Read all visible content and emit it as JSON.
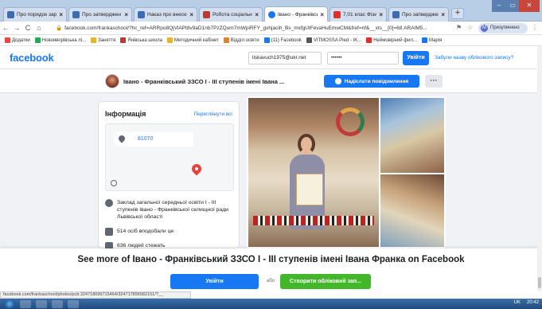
{
  "browser": {
    "tabs": [
      {
        "label": "Про порядок зар",
        "color": "#3b6cb7"
      },
      {
        "label": "Про затверджен",
        "color": "#3b6cb7"
      },
      {
        "label": "Наказ про внесен",
        "color": "#3b6cb7"
      },
      {
        "label": "Робота соціальн",
        "color": "#c0392b"
      },
      {
        "label": "Івано - Франківсь",
        "color": "#1877f2"
      },
      {
        "label": "7,01 клас Фізика",
        "color": "#e52d27"
      },
      {
        "label": "Про затверджен",
        "color": "#3b6cb7"
      }
    ],
    "url": "facebook.com/frankaschool/?hc_ref=ARRpo8QjVlAPt8v9aD1nb7PzZQum7mWpiRFY_gvhjacih_Bs_mxfgUtFevaHuEmwCM&fref=nf&__xts__[0]=68.ARAIM5...",
    "profile_label": "Призупинено",
    "bookmarks": [
      {
        "label": "Додатки",
        "color": "#e44"
      },
      {
        "label": "Новояворівська лі...",
        "color": "#2a5"
      },
      {
        "label": "Заняття",
        "color": "#e9b22c"
      },
      {
        "label": "Янівська школа",
        "color": "#c0392b"
      },
      {
        "label": "Методичний кабінет",
        "color": "#e9b22c"
      },
      {
        "label": "Відділ освіти",
        "color": "#e67e22"
      },
      {
        "label": "(11) Facebook",
        "color": "#1877f2"
      },
      {
        "label": "VITMOSSA Pied - IK...",
        "color": "#555"
      },
      {
        "label": "Неймовірний фил...",
        "color": "#e52d27"
      },
      {
        "label": "Марія",
        "color": "#1877f2"
      }
    ]
  },
  "fb": {
    "logo": "facebook",
    "email_value": "liskavuch1975@ukr.net",
    "password_value": "••••••",
    "login_label": "Увійти",
    "forgot_label": "Забули назву облікового запису?",
    "page_name": "Івано - Франківський ЗЗСО І - ІІІ ступенів імені Івана ...",
    "message_label": "Надіслати повідомлення",
    "more_label": "···"
  },
  "info": {
    "title": "Інформація",
    "view_all": "Переглянути всі",
    "zip": "81070",
    "description": "Заклад загальної середньої освіти І - ІІІ ступенів Івано - Франківської селищної ради Львівської області",
    "likes": "514 осіб вподобали це",
    "follows": "636 людей стежать"
  },
  "overlay": {
    "see_more": "See more of Івано - Франківський ЗЗСО І - ІІІ ступенів імені Івана Франка on Facebook",
    "login_label": "Увійти",
    "or_label": "або",
    "create_label": "Створити обліковий зап..."
  },
  "status_url": "facebook.com/frankaschool/photos/pcb.324718099715464/324717896582151/?__",
  "tray": {
    "lang": "UK",
    "time": "20:42"
  }
}
